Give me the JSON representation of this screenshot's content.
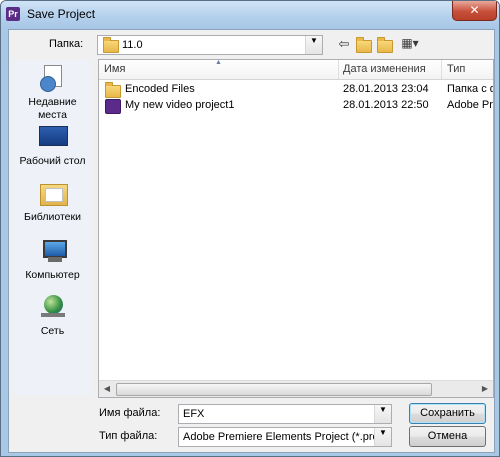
{
  "window": {
    "title": "Save Project",
    "close_label": "✕"
  },
  "lookin": {
    "label": "Папка:",
    "value": "11.0"
  },
  "places": [
    {
      "label": "Недавние места",
      "icon": "recent-places-icon"
    },
    {
      "label": "Рабочий стол",
      "icon": "desktop-icon"
    },
    {
      "label": "Библиотеки",
      "icon": "libraries-icon"
    },
    {
      "label": "Компьютер",
      "icon": "computer-icon"
    },
    {
      "label": "Сеть",
      "icon": "network-icon"
    }
  ],
  "list": {
    "columns": [
      "Имя",
      "Дата изменения",
      "Тип"
    ],
    "rows": [
      {
        "name": "Encoded Files",
        "date": "28.01.2013 23:04",
        "type": "Папка с ф",
        "icon": "folder-icon"
      },
      {
        "name": "My new video project1",
        "date": "28.01.2013 22:50",
        "type": "Adobe Pre",
        "icon": "premiere-project-icon"
      }
    ]
  },
  "filename": {
    "label": "Имя файла:",
    "value": "EFX"
  },
  "filetype": {
    "label": "Тип файла:",
    "value": "Adobe Premiere Elements Project (*.prel)"
  },
  "buttons": {
    "save": "Сохранить",
    "cancel": "Отмена"
  }
}
